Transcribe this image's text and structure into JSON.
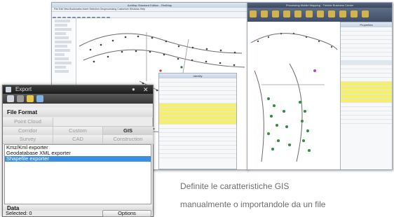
{
  "background_windows": {
    "left_window_title": "ArcMap Standard Edition - RedMap",
    "left_menu": "File  Edit  View  Bookmarks  Insert  Selection  Geoprocessing  Customize  Windows  Help",
    "toc_title": "Table Of Contents",
    "attribute_panel_title": "Identify",
    "right_window_title": "Processing Mobile Mapping - Trimble Business Center",
    "right_panel_title": "Properties"
  },
  "export_dialog": {
    "title": "Export",
    "close_icon": "close-icon",
    "toolbar_icons": [
      "grid-icon",
      "point-cloud-icon",
      "pin-icon",
      "layers-icon"
    ],
    "file_format_heading": "File Format",
    "tabs_row1": [
      {
        "label": "Point Cloud",
        "selected": false
      }
    ],
    "tabs_row2": [
      {
        "label": "Corridor",
        "selected": false
      },
      {
        "label": "Custom",
        "selected": false
      },
      {
        "label": "GIS",
        "selected": true
      }
    ],
    "tabs_row3": [
      {
        "label": "Survey",
        "selected": false
      },
      {
        "label": "CAD",
        "selected": false
      },
      {
        "label": "Construction",
        "selected": false
      }
    ],
    "list_items": [
      {
        "label": "Kmz/Kml exporter",
        "selected": false
      },
      {
        "label": "Geodatabase XML exporter",
        "selected": false
      },
      {
        "label": "Shapefile exporter",
        "selected": true
      }
    ],
    "data_heading": "Data",
    "selected_count": "Selected: 0",
    "options_button": "Options"
  },
  "caption": {
    "line1": "Definite le caratteristiche GIS",
    "line2": "manualmente o importandole da un file"
  },
  "colors": {
    "selection_blue": "#3c8ee2",
    "highlight_yellow": "#f5ef6a",
    "caption_grey": "#6e6e6e"
  }
}
